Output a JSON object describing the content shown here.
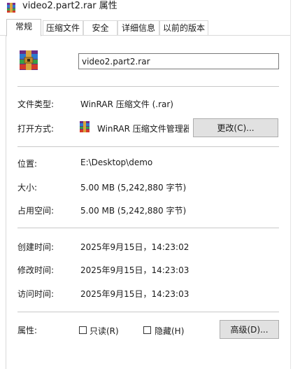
{
  "window": {
    "title": "video2.part2.rar 属性"
  },
  "tabs": [
    {
      "label": "常规",
      "active": true
    },
    {
      "label": "压缩文件",
      "active": false
    },
    {
      "label": "安全",
      "active": false
    },
    {
      "label": "详细信息",
      "active": false
    },
    {
      "label": "以前的版本",
      "active": false
    }
  ],
  "file": {
    "name": "video2.part2.rar",
    "icon": "winrar-archive-icon"
  },
  "props": {
    "type_label": "文件类型:",
    "type_value": "WinRAR 压缩文件 (.rar)",
    "opens_with_label": "打开方式:",
    "opens_with_value": "WinRAR 压缩文件管理器",
    "change_button": "更改(C)...",
    "location_label": "位置:",
    "location_value": "E:\\Desktop\\demo",
    "size_label": "大小:",
    "size_value": "5.00 MB (5,242,880 字节)",
    "size_on_disk_label": "占用空间:",
    "size_on_disk_value": "5.00 MB (5,242,880 字节)",
    "created_label": "创建时间:",
    "created_value": "2025年9月15日，14:23:02",
    "modified_label": "修改时间:",
    "modified_value": "2025年9月15日，14:23:03",
    "accessed_label": "访问时间:",
    "accessed_value": "2025年9月15日，14:23:03",
    "attributes_label": "属性:",
    "readonly_label": "只读(R)",
    "readonly_checked": false,
    "hidden_label": "隐藏(H)",
    "hidden_checked": false,
    "advanced_button": "高级(D)..."
  },
  "colors": {
    "background": "#ffffff",
    "border": "#d9d9d9",
    "button_face": "#e1e1e1"
  }
}
